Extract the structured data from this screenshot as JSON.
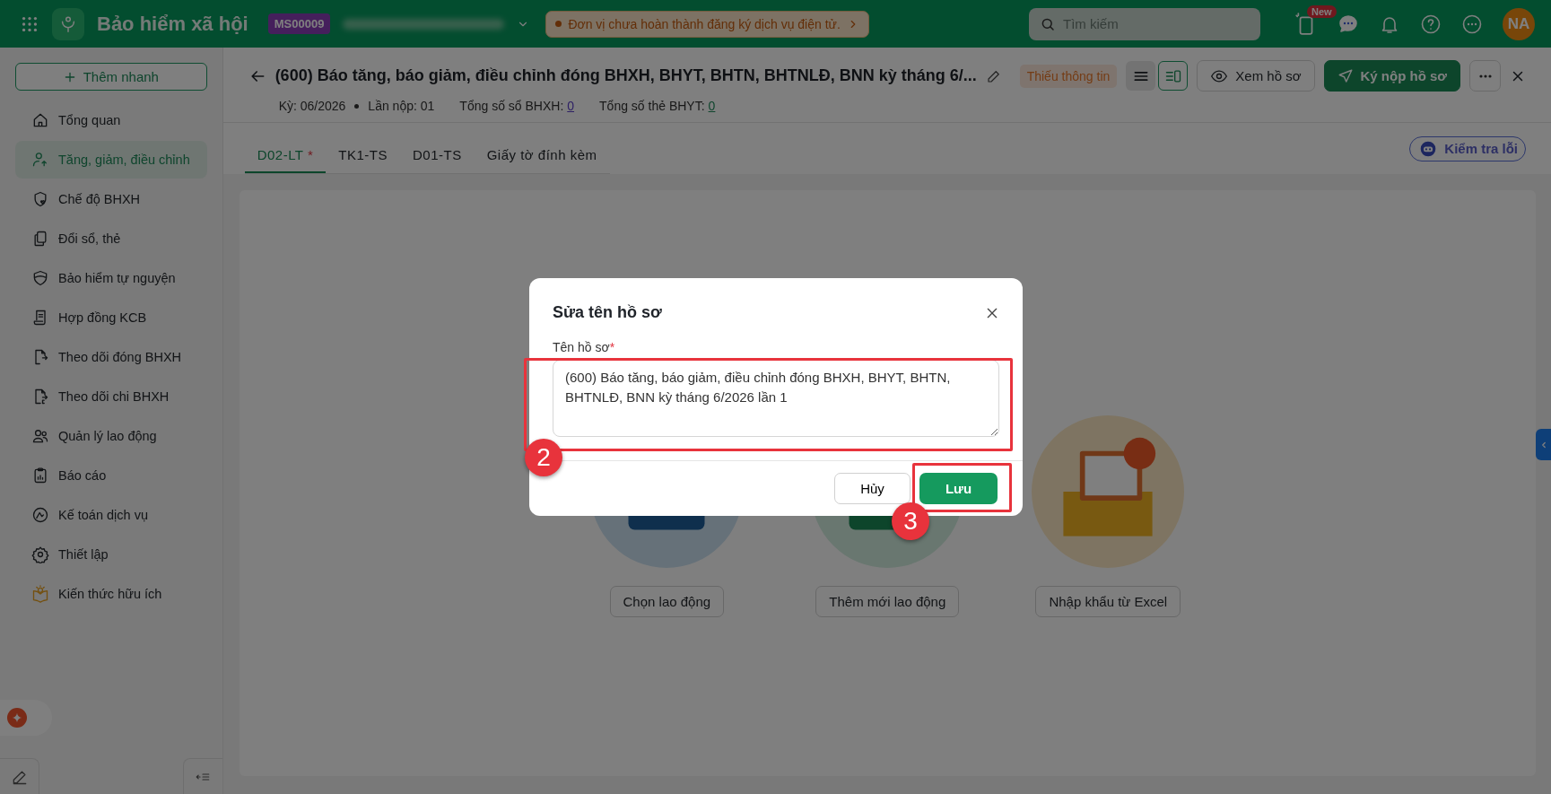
{
  "app": {
    "name": "Bảo hiểm xã hội",
    "code": "MS00009",
    "notice": "Đơn vị chưa hoàn thành đăng ký dịch vụ điện tử.",
    "search": {
      "placeholder": "Tìm kiếm"
    },
    "new_badge": "New",
    "avatar": "NA"
  },
  "sidebar": {
    "quick_add": "Thêm nhanh",
    "items": [
      {
        "label": "Tổng quan",
        "selected": false
      },
      {
        "label": "Tăng, giảm, điều chỉnh",
        "selected": true
      },
      {
        "label": "Chế độ BHXH",
        "selected": false
      },
      {
        "label": "Đổi sổ, thẻ",
        "selected": false
      },
      {
        "label": "Bảo hiểm tự nguyện",
        "selected": false
      },
      {
        "label": "Hợp đồng KCB",
        "selected": false
      },
      {
        "label": "Theo dõi đóng BHXH",
        "selected": false
      },
      {
        "label": "Theo dõi chi BHXH",
        "selected": false
      },
      {
        "label": "Quản lý lao động",
        "selected": false
      },
      {
        "label": "Báo cáo",
        "selected": false
      },
      {
        "label": "Kế toán dịch vụ",
        "selected": false
      },
      {
        "label": "Thiết lập",
        "selected": false
      },
      {
        "label": "Kiến thức hữu ích",
        "selected": false
      }
    ]
  },
  "header": {
    "title": "(600) Báo tăng, báo giảm, điều chỉnh đóng BHXH, BHYT, BHTN, BHTNLĐ, BNN kỳ tháng 6/...",
    "status": "Thiếu thông tin",
    "view_modes": [
      {
        "selected": false
      },
      {
        "selected": true
      }
    ],
    "view_button": "Xem hồ sơ",
    "submit_button": "Ký nộp hồ sơ",
    "meta": [
      {
        "label": "Kỳ: 06/2026"
      },
      {
        "label": "Lần nộp: 01"
      },
      {
        "label": "Tổng số sổ BHXH:",
        "value": "0"
      },
      {
        "label": "Tổng số thẻ BHYT:",
        "value": "0"
      }
    ]
  },
  "tabs": [
    {
      "label": "D02-LT",
      "required_mark": "*",
      "selected": true
    },
    {
      "label": "TK1-TS",
      "selected": false
    },
    {
      "label": "D01-TS",
      "selected": false
    },
    {
      "label": "Giấy tờ đính kèm",
      "selected": false
    }
  ],
  "check_button": "Kiểm tra lỗi",
  "actions": [
    {
      "kind": "choose",
      "label": "Chọn lao động"
    },
    {
      "kind": "add",
      "label": "Thêm mới lao động"
    },
    {
      "kind": "import",
      "label": "Nhập khẩu từ Excel"
    }
  ],
  "dialog": {
    "title": "Sửa tên hồ sơ",
    "field_label": "Tên hồ sơ",
    "required_mark": "*",
    "value": "(600) Báo tăng, báo giảm, điều chỉnh đóng BHXH, BHYT, BHTN, BHTNLĐ, BNN kỳ tháng 6/2026 lần 1",
    "cancel": "Hủy",
    "save": "Lưu"
  },
  "annotations": [
    {
      "label": "2"
    },
    {
      "label": "3"
    }
  ]
}
